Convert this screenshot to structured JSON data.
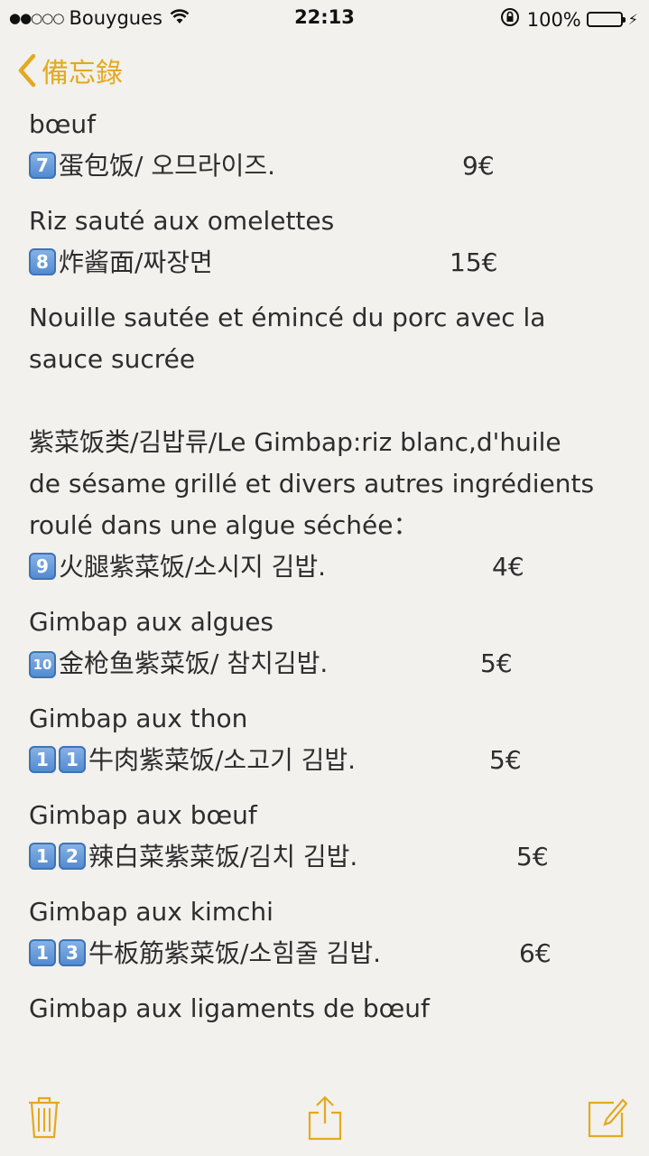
{
  "status_bar": {
    "signal": "●●○○○",
    "carrier": "Bouygues",
    "time": "22:13",
    "battery_percent": "100%",
    "battery_level": 1.0
  },
  "nav": {
    "back_label": "備忘錄"
  },
  "note": {
    "line1": "bœuf",
    "item7": {
      "key": "7",
      "name": "蛋包饭/ 오므라이즈.",
      "price": "9€"
    },
    "desc7": "Riz sauté aux omelettes",
    "item8": {
      "key": "8",
      "name": "炸酱面/짜장면",
      "price": "15€"
    },
    "desc8_1": "Nouille sautée et émincé du porc avec la",
    "desc8_2": "sauce sucrée",
    "section_1": "紫菜饭类/김밥류/Le Gimbap:riz blanc,d'huile",
    "section_2": "de sésame grillé et divers autres ingrédients",
    "section_3": "roulé dans une algue séchée：",
    "item9": {
      "key": "9",
      "name": "火腿紫菜饭/소시지 김밥.",
      "price": "4€"
    },
    "desc9": "Gimbap aux algues",
    "item10": {
      "key": "10",
      "name": "金枪鱼紫菜饭/ 참치김밥.",
      "price": "5€"
    },
    "desc10": "Gimbap aux thon",
    "item11": {
      "key_a": "1",
      "key_b": "1",
      "name": "牛肉紫菜饭/소고기 김밥.",
      "price": "5€"
    },
    "desc11": "Gimbap aux bœuf",
    "item12": {
      "key_a": "1",
      "key_b": "2",
      "name": "辣白菜紫菜饭/김치 김밥.",
      "price": "5€"
    },
    "desc12": "Gimbap aux kimchi",
    "item13": {
      "key_a": "1",
      "key_b": "3",
      "name": "牛板筋紫菜饭/소힘줄 김밥.",
      "price": "6€"
    },
    "desc13": "Gimbap aux ligaments de bœuf"
  },
  "toolbar": {
    "icons": [
      "trash-icon",
      "share-icon",
      "compose-icon"
    ]
  },
  "colors": {
    "accent": "#e3a91f",
    "background": "#f2f1ee",
    "text": "#2d2d2d",
    "battery": "#4cd964"
  }
}
